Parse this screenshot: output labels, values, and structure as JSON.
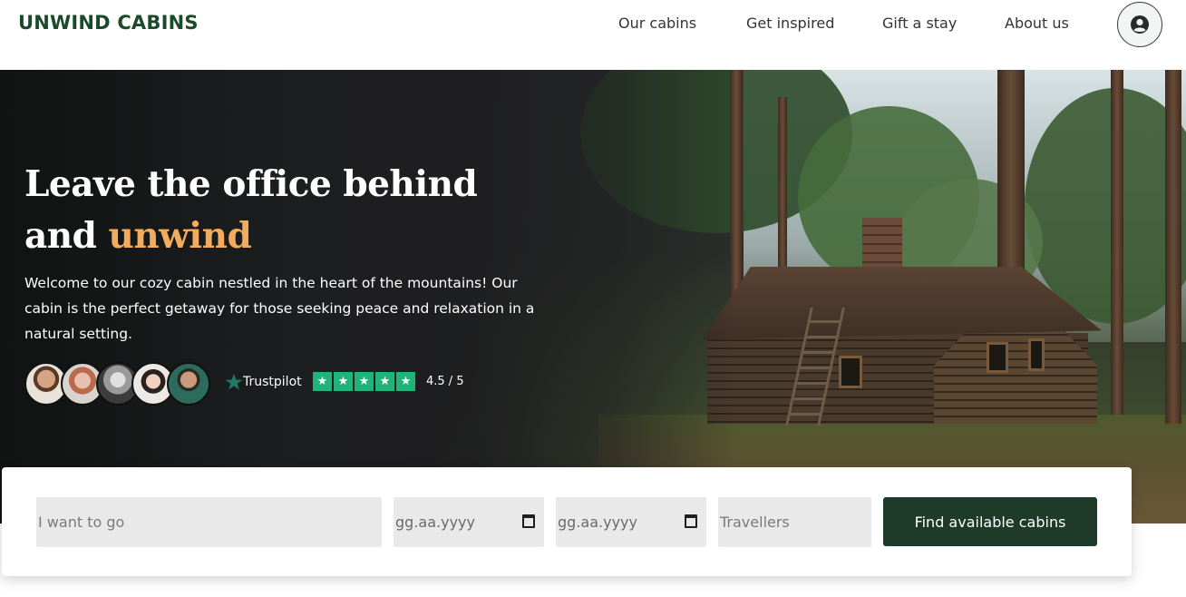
{
  "header": {
    "logo": "UNWIND CABINS",
    "nav": [
      "Our cabins",
      "Get inspired",
      "Gift a stay",
      "About us"
    ],
    "account_icon": "user-circle-icon"
  },
  "hero": {
    "title_line1": "Leave the office behind",
    "title_line2_prefix": "and ",
    "title_line2_accent": "unwind",
    "description": "Welcome to our cozy cabin nestled in the heart of the mountains! Our cabin is the perfect getaway for those seeking peace and relaxation in a natural setting.",
    "trustpilot_label": "Trustpilot",
    "rating_stars": 5,
    "rating_text": "4.5 / 5"
  },
  "search": {
    "destination_placeholder": "I want to go",
    "checkin_placeholder": "gg.aa.yyyy",
    "checkout_placeholder": "gg.aa.yyyy",
    "travellers_placeholder": "Travellers",
    "submit_label": "Find available cabins"
  },
  "colors": {
    "brand": "#1b4a2a",
    "accent": "#f3ab5c",
    "button": "#1e3b29",
    "trustpilot_green": "#1fb57a"
  }
}
